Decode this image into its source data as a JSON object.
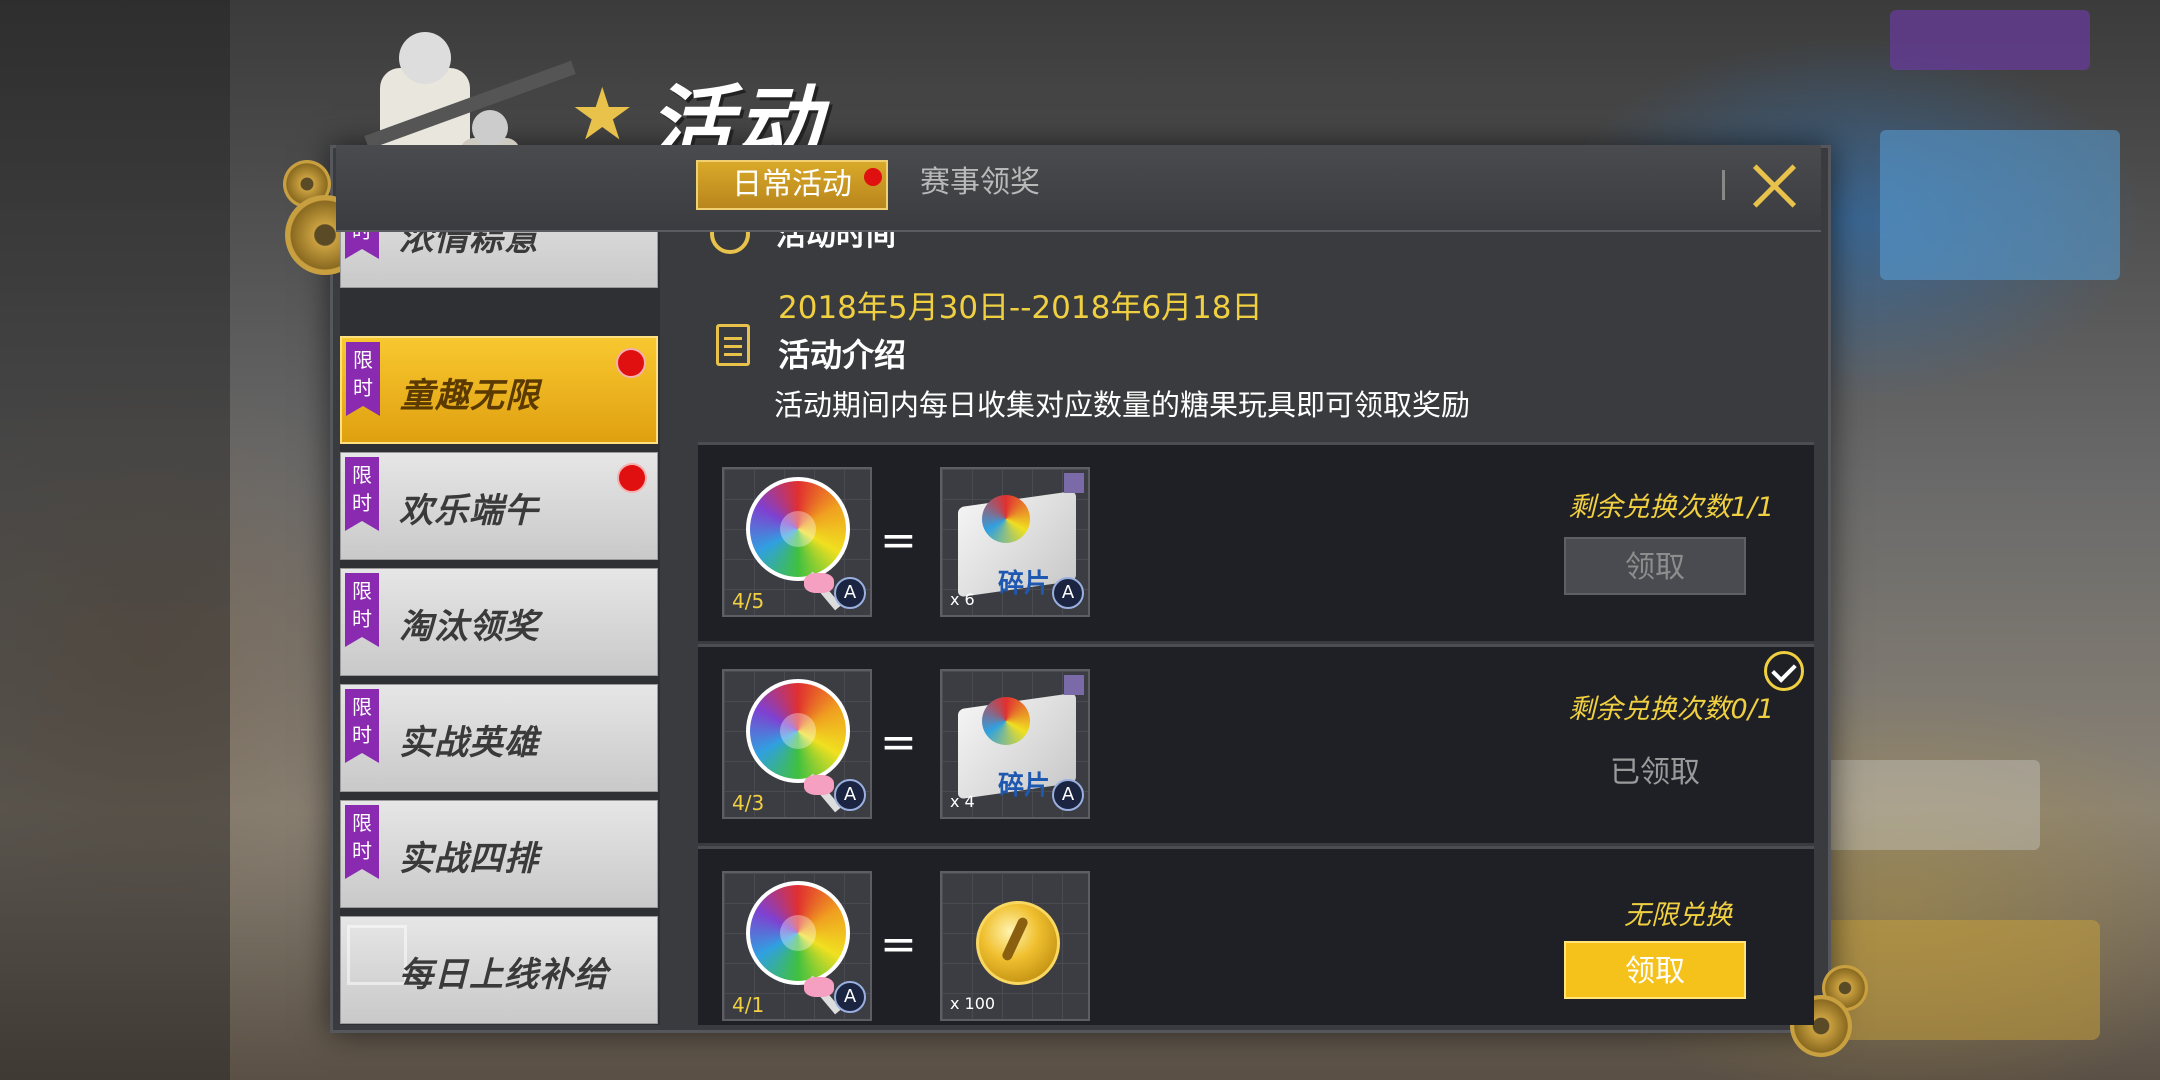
{
  "header": {
    "title": "活动",
    "tabs": [
      {
        "label": "日常活动",
        "active": true,
        "notify": true
      },
      {
        "label": "赛事领奖",
        "active": false,
        "notify": false
      }
    ]
  },
  "sidebar": {
    "items": [
      {
        "label": "浓情粽意",
        "tag": "限时",
        "notify": true,
        "active": false
      },
      {
        "label": "童趣无限",
        "tag": "限时",
        "notify": true,
        "active": true
      },
      {
        "label": "欢乐端午",
        "tag": "限时",
        "notify": true,
        "active": false
      },
      {
        "label": "淘汰领奖",
        "tag": "限时",
        "notify": false,
        "active": false
      },
      {
        "label": "实战英雄",
        "tag": "限时",
        "notify": false,
        "active": false
      },
      {
        "label": "实战四排",
        "tag": "限时",
        "notify": false,
        "active": false
      },
      {
        "label": "每日上线补给",
        "tag": "",
        "notify": false,
        "active": false
      }
    ]
  },
  "content": {
    "time_heading": "活动时间",
    "date_range": "2018年5月30日--2018年6月18日",
    "intro_heading": "活动介绍",
    "intro_text": "活动期间内每日收集对应数量的糖果玩具即可领取奖励",
    "rewards": [
      {
        "cost": "4/5",
        "reward_type": "fragment",
        "reward_label": "碎片",
        "reward_qty": "x 6",
        "remaining": "剩余兑换次数1/1",
        "button": "领取",
        "state": "disabled"
      },
      {
        "cost": "4/3",
        "reward_type": "fragment",
        "reward_label": "碎片",
        "reward_qty": "x 4",
        "remaining": "剩余兑换次数0/1",
        "button": "已领取",
        "state": "claimed"
      },
      {
        "cost": "4/1",
        "reward_type": "coin",
        "reward_label": "",
        "reward_qty": "x 100",
        "remaining": "无限兑换",
        "button": "领取",
        "state": "active"
      }
    ],
    "badge_letter": "A"
  },
  "colors": {
    "accent": "#f5c21c",
    "notify": "#e01010",
    "limited_tag": "#8a2ab0"
  }
}
